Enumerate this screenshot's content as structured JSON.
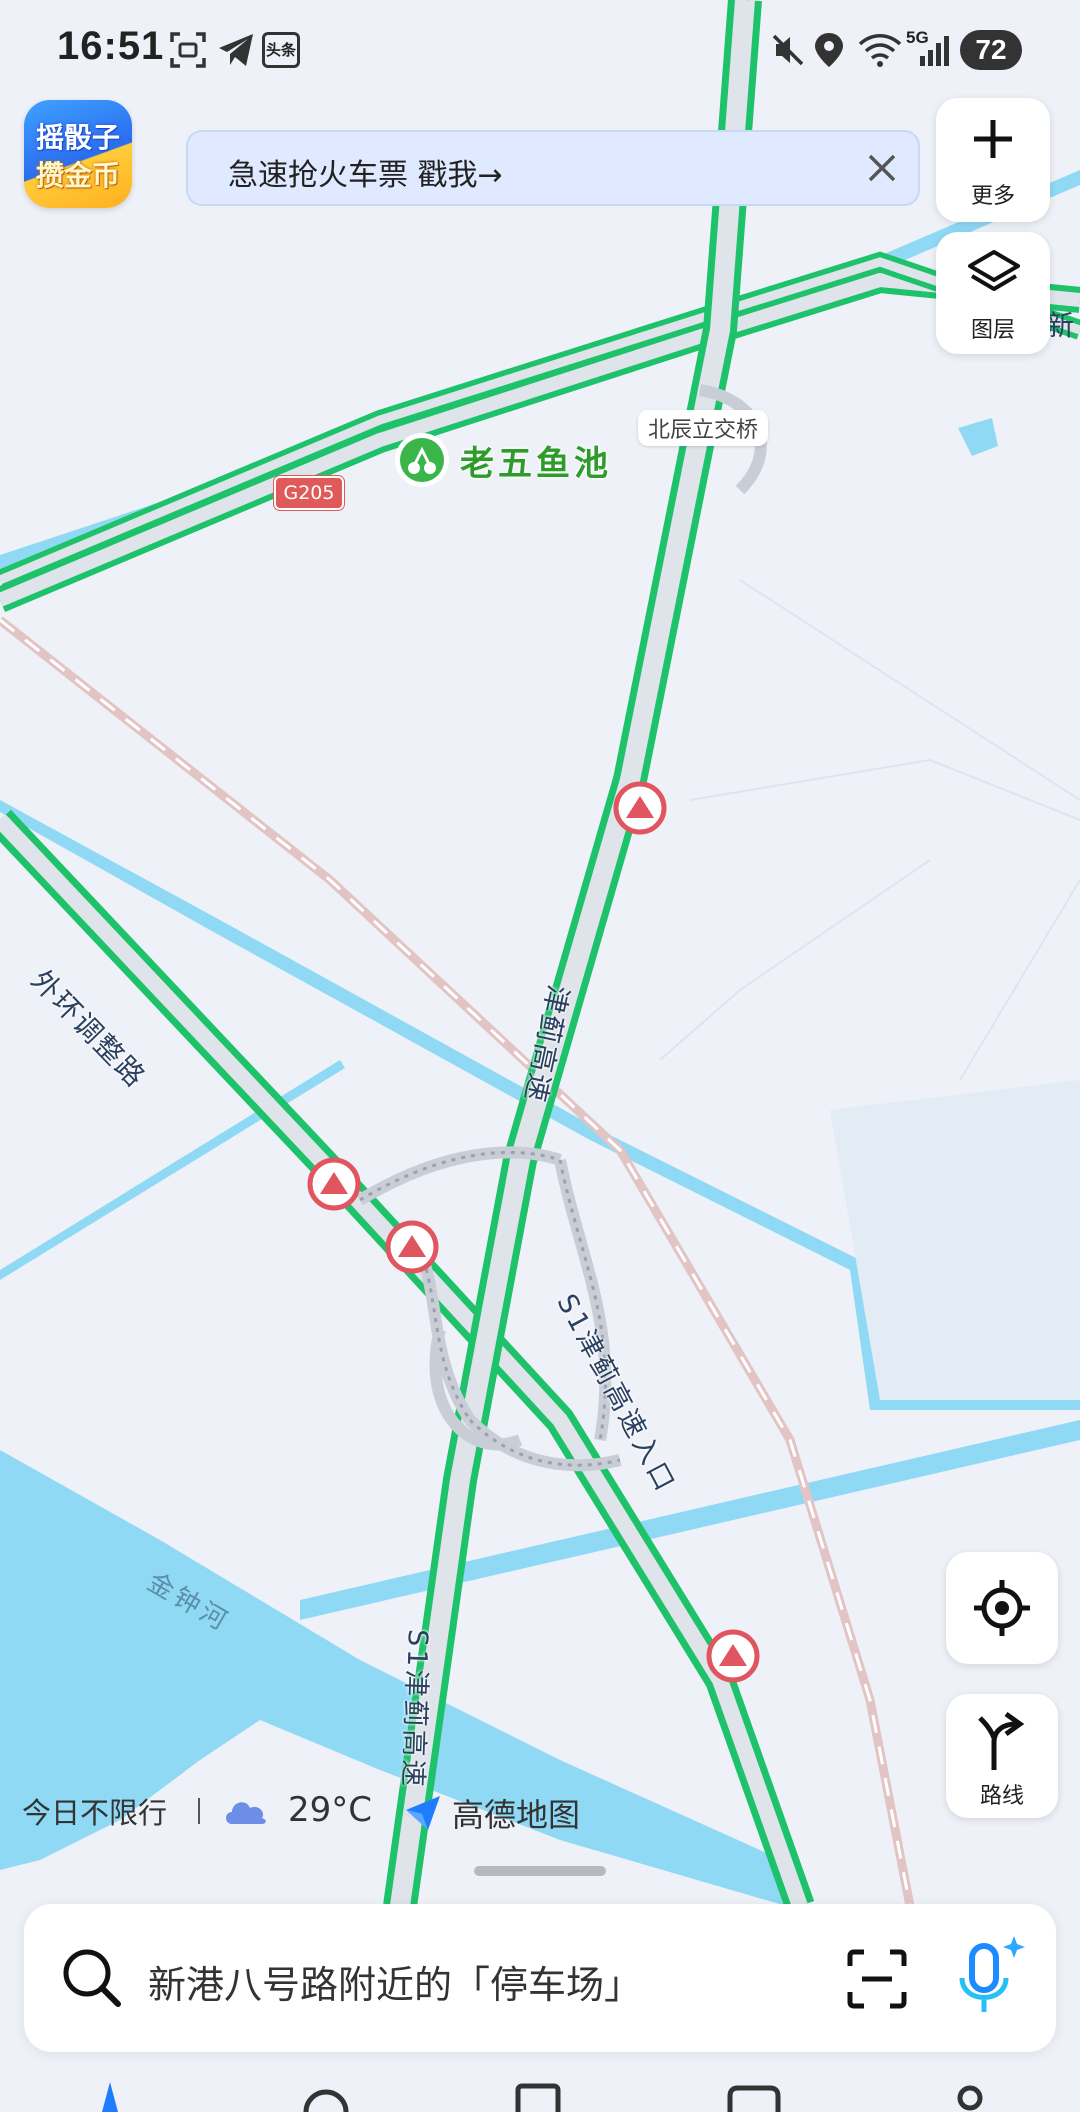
{
  "status_bar": {
    "time": "16:51",
    "notification_icons": [
      "screenshot-icon",
      "telegram-icon",
      "toutiao-icon"
    ],
    "toutiao_label": "头条",
    "system_icons": [
      "mute-icon",
      "location-icon",
      "wifi-icon",
      "signal-5g-icon"
    ],
    "network": "5G",
    "battery": "72"
  },
  "promo_logo": {
    "line1": "摇骰子",
    "line2": "攒金币"
  },
  "banner": {
    "text": "急速抢火车票   戳我→"
  },
  "right_buttons": {
    "more": {
      "icon": "plus-icon",
      "label": "更多"
    },
    "layers": {
      "icon": "layers-icon",
      "label": "图层"
    }
  },
  "map": {
    "labels": {
      "poi": "老五鱼池",
      "interchange": "北辰立交桥",
      "highway_badge": "G205",
      "road_waihuan": "外环调整路",
      "road_jinji": "津蓟高速",
      "ramp": "S1津蓟高速入口",
      "road_s1": "S1津蓟高速",
      "river": "金钟河",
      "edge_partial": "新",
      "edge_partial2": "新"
    },
    "colors": {
      "traffic_green": "#1dc26a",
      "road_fill": "#dfe3ea",
      "water": "#8fd9f5",
      "rail": "#e8c4c4"
    }
  },
  "bottom_info": {
    "restriction": "今日不限行",
    "weather_icon": "cloud-icon",
    "temperature": "29°C",
    "brand": "高德地图"
  },
  "map_controls": {
    "locate": {
      "icon": "locate-icon"
    },
    "route": {
      "icon": "route-icon",
      "label": "路线"
    }
  },
  "search": {
    "placeholder": "新港八号路附近的「停车场」",
    "scan_icon": "scan-icon",
    "voice_icon": "voice-assistant-icon"
  }
}
